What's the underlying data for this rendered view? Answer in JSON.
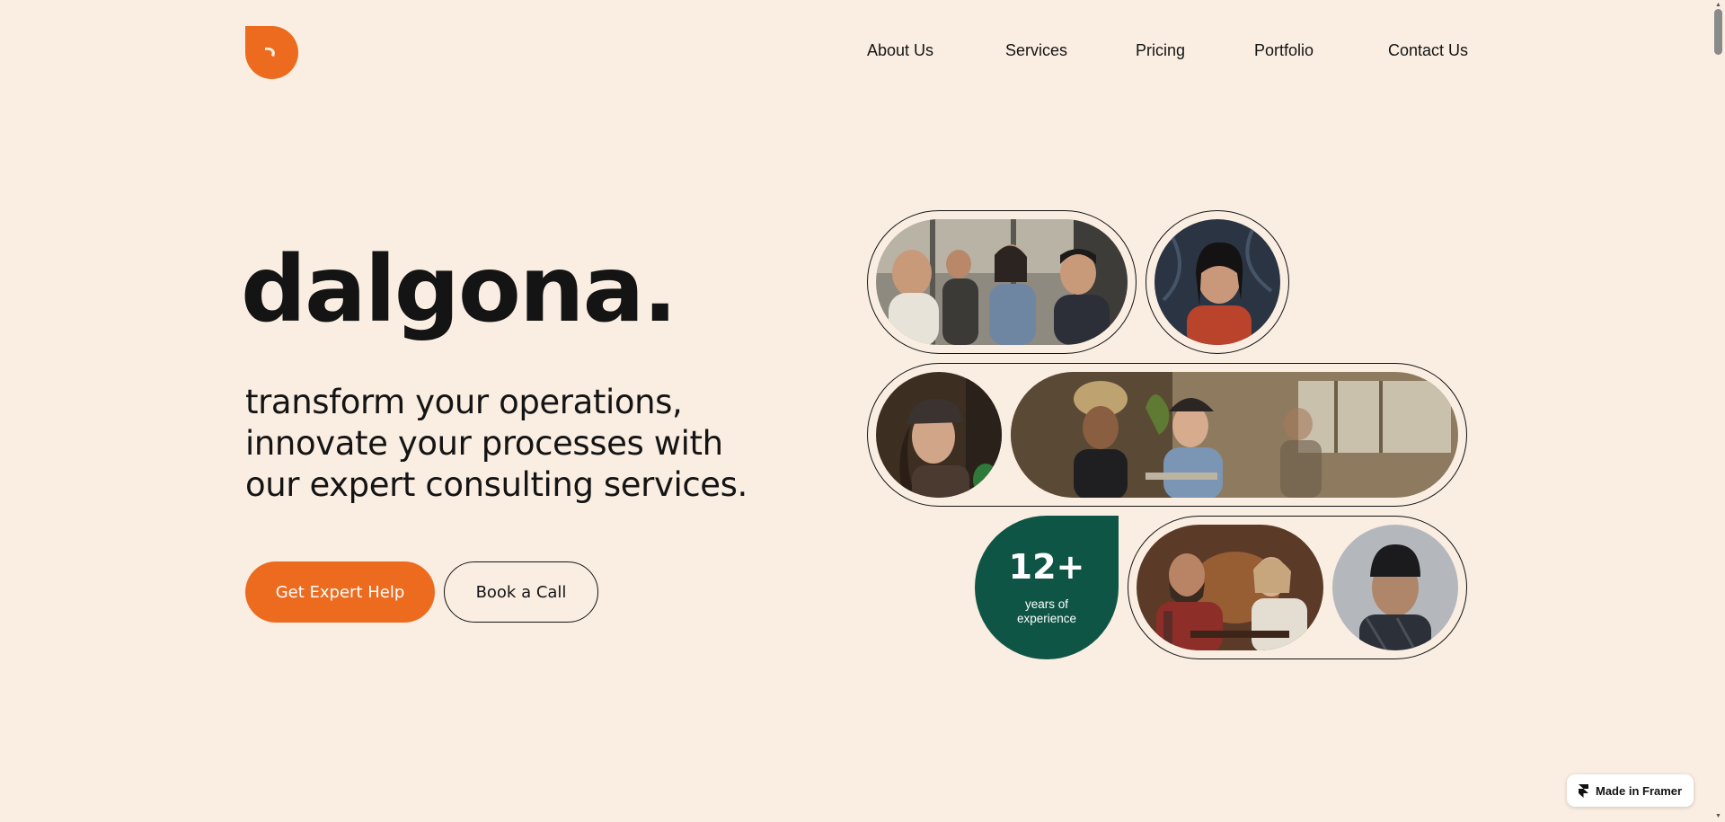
{
  "logo": {
    "icon": "dalgona-logo-icon",
    "color": "#EC6B1F"
  },
  "nav": {
    "items": [
      "About Us",
      "Services",
      "Pricing",
      "Portfolio",
      "Contact Us"
    ]
  },
  "hero": {
    "brand": "dalgona.",
    "tagline": "transform your operations, innovate your processes with our expert consulting services.",
    "primary_cta": "Get Expert Help",
    "secondary_cta": "Book a Call"
  },
  "stat": {
    "value": "12+",
    "label": "years of experience",
    "color": "#0F5546"
  },
  "photos": [
    "team-meeting-photo",
    "woman-portrait-photo",
    "woman-with-cap-photo",
    "cafe-meeting-photo",
    "dinner-conversation-photo",
    "man-beanie-portrait-photo"
  ],
  "badge": {
    "label": "Made in Framer"
  },
  "colors": {
    "background": "#FAEEE2",
    "accent": "#EC6B1F",
    "dark_green": "#0F5546",
    "text": "#141414"
  }
}
